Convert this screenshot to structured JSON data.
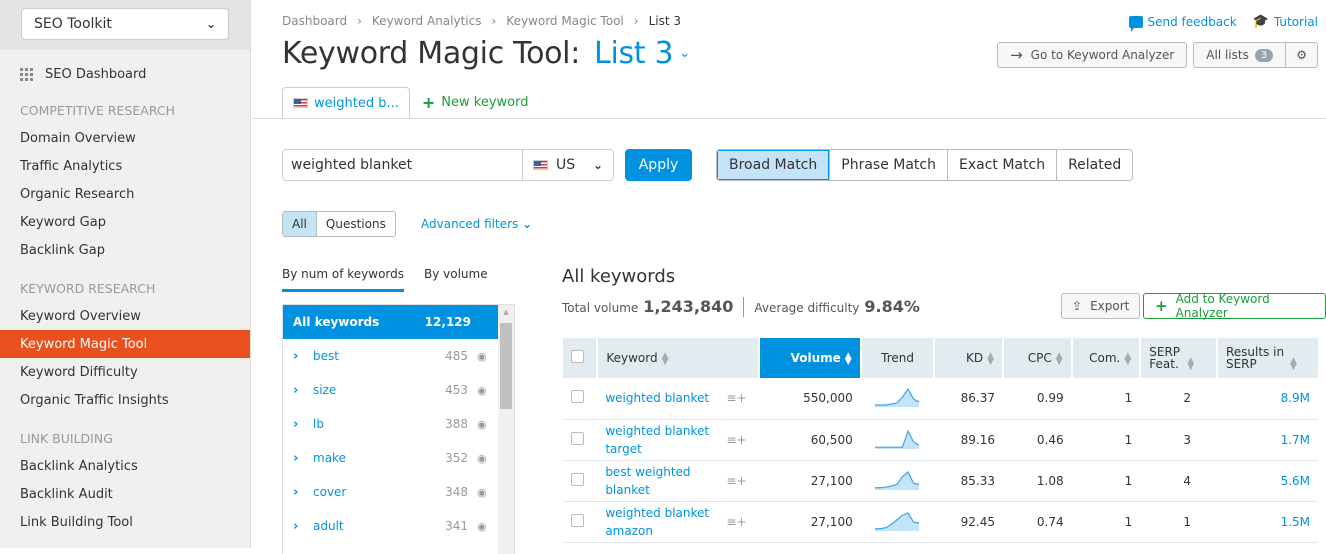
{
  "sidebar": {
    "toolkit": "SEO Toolkit",
    "dashboard": "SEO Dashboard",
    "sections": [
      {
        "title": "COMPETITIVE RESEARCH",
        "items": [
          "Domain Overview",
          "Traffic Analytics",
          "Organic Research",
          "Keyword Gap",
          "Backlink Gap"
        ]
      },
      {
        "title": "KEYWORD RESEARCH",
        "items": [
          "Keyword Overview",
          "Keyword Magic Tool",
          "Keyword Difficulty",
          "Organic Traffic Insights"
        ]
      },
      {
        "title": "LINK BUILDING",
        "items": [
          "Backlink Analytics",
          "Backlink Audit",
          "Link Building Tool"
        ]
      }
    ],
    "active_item": "Keyword Magic Tool"
  },
  "header": {
    "breadcrumb": [
      "Dashboard",
      "Keyword Analytics",
      "Keyword Magic Tool",
      "List 3"
    ],
    "title": "Keyword Magic Tool:",
    "list_name": "List 3",
    "send_feedback": "Send feedback",
    "tutorial": "Tutorial",
    "go_to_analyzer": "Go to Keyword Analyzer",
    "all_lists": "All lists",
    "all_lists_count": "3"
  },
  "tabs": {
    "active_tab": "weighted b...",
    "new_keyword": "New keyword"
  },
  "search": {
    "value": "weighted blanket",
    "database": "US",
    "apply": "Apply"
  },
  "match_types": [
    {
      "label": "Broad Match",
      "active": true
    },
    {
      "label": "Phrase Match",
      "active": false
    },
    {
      "label": "Exact Match",
      "active": false
    },
    {
      "label": "Related",
      "active": false
    }
  ],
  "filters": {
    "all": "All",
    "questions": "Questions",
    "advanced": "Advanced filters"
  },
  "groups": {
    "tabs": [
      "By num of keywords",
      "By volume"
    ],
    "all_label": "All keywords",
    "all_count": "12,129",
    "items": [
      {
        "name": "best",
        "count": "485"
      },
      {
        "name": "size",
        "count": "453"
      },
      {
        "name": "lb",
        "count": "388"
      },
      {
        "name": "make",
        "count": "352"
      },
      {
        "name": "cover",
        "count": "348"
      },
      {
        "name": "adult",
        "count": "341"
      }
    ]
  },
  "results": {
    "heading": "All keywords",
    "total_volume_label": "Total volume",
    "total_volume": "1,243,840",
    "avg_difficulty_label": "Average difficulty",
    "avg_difficulty": "9.84%",
    "export": "Export",
    "add_to_analyzer": "Add to Keyword Analyzer",
    "columns": [
      "Keyword",
      "Volume",
      "Trend",
      "KD",
      "CPC",
      "Com.",
      "SERP Feat.",
      "Results in SERP"
    ],
    "rows": [
      {
        "keyword": "weighted blanket",
        "volume": "550,000",
        "trend": [
          1,
          1,
          1,
          1.5,
          2,
          5,
          9,
          4,
          2.5
        ],
        "kd": "86.37",
        "cpc": "0.99",
        "com": "1",
        "serp": "2",
        "results": "8.9M"
      },
      {
        "keyword": "weighted blanket target",
        "volume": "60,500",
        "trend": [
          1,
          1,
          1,
          1,
          1,
          1,
          10,
          4,
          2
        ],
        "kd": "89.16",
        "cpc": "0.46",
        "com": "1",
        "serp": "3",
        "results": "1.7M"
      },
      {
        "keyword": "best weighted blanket",
        "volume": "27,100",
        "trend": [
          1,
          1,
          1.3,
          1.8,
          2.5,
          6,
          8,
          3,
          2.5
        ],
        "kd": "85.33",
        "cpc": "1.08",
        "com": "1",
        "serp": "4",
        "results": "5.6M"
      },
      {
        "keyword": "weighted blanket amazon",
        "volume": "27,100",
        "trend": [
          1,
          1,
          1.5,
          3,
          5,
          7,
          8,
          4,
          3.5
        ],
        "kd": "92.45",
        "cpc": "0.74",
        "com": "1",
        "serp": "1",
        "results": "1.5M"
      }
    ]
  }
}
